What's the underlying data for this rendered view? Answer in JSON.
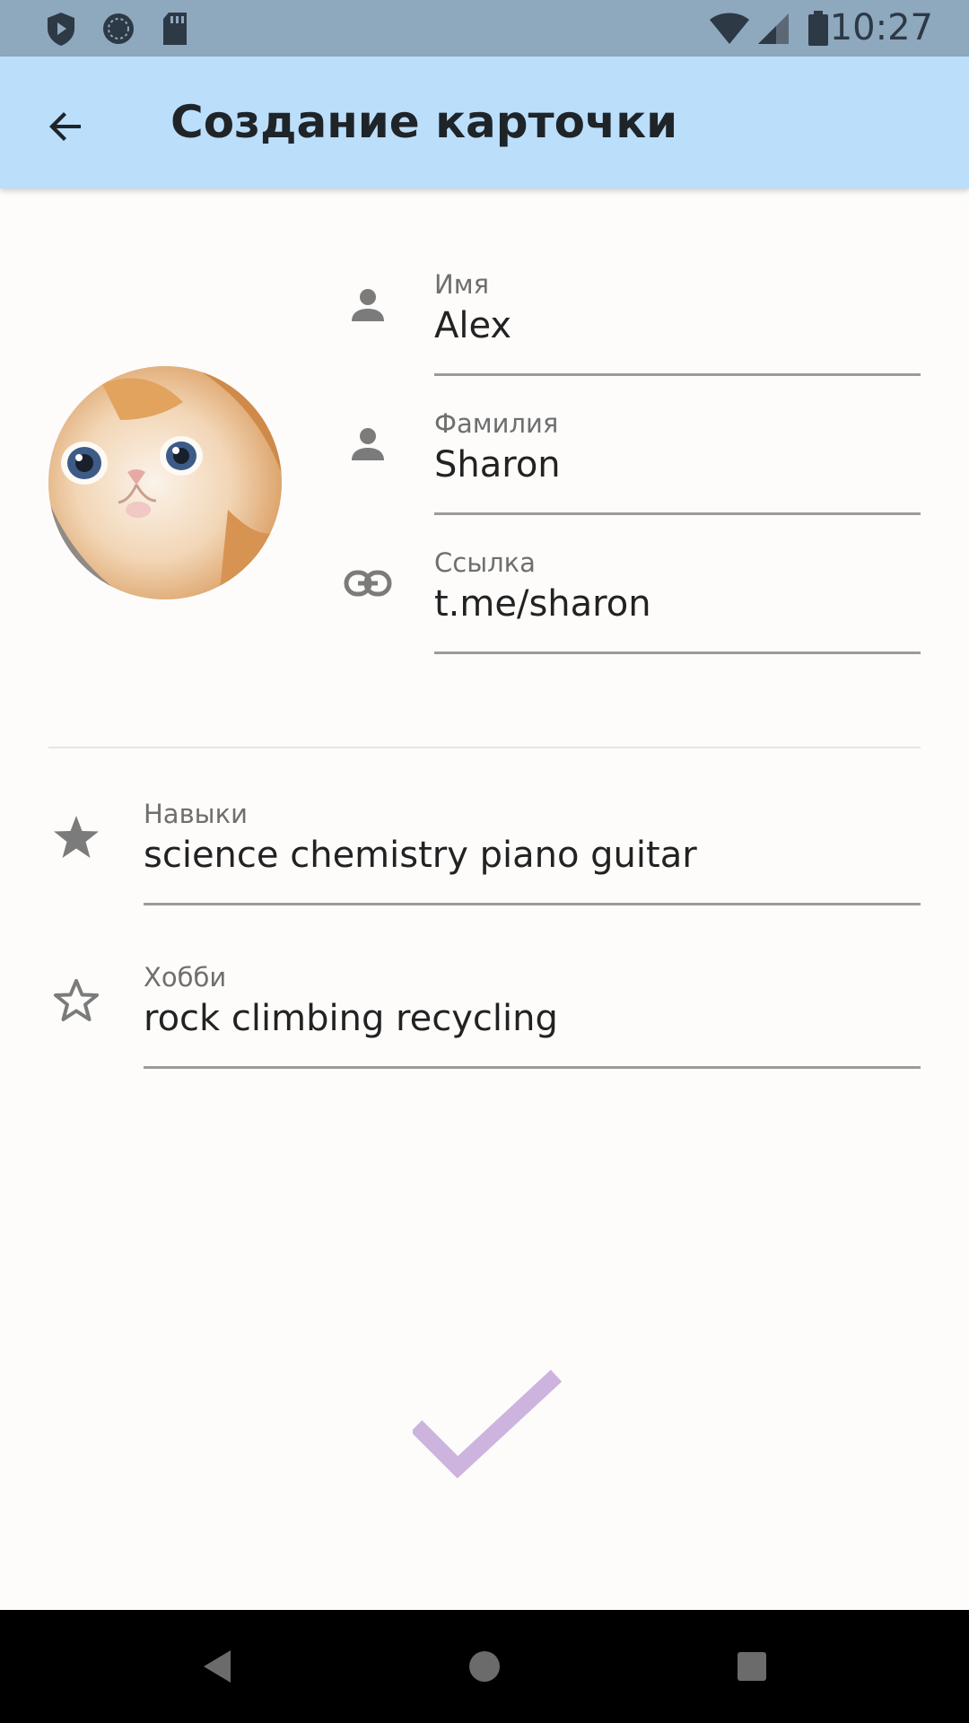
{
  "status_bar": {
    "time": "10:27",
    "icons": [
      "shield-icon",
      "sync-icon",
      "sd-card-icon",
      "wifi-icon",
      "signal-icon",
      "battery-icon"
    ]
  },
  "app_bar": {
    "title": "Создание карточки",
    "back_icon": "arrow-back-icon",
    "background": "#bbdefb"
  },
  "profile": {
    "avatar": "kitten-photo",
    "fields": [
      {
        "icon": "person-icon",
        "label": "Имя",
        "value": "Alex"
      },
      {
        "icon": "person-icon",
        "label": "Фамилия",
        "value": "Sharon"
      },
      {
        "icon": "link-icon",
        "label": "Ссылка",
        "value": "t.me/sharon"
      }
    ]
  },
  "details": {
    "fields": [
      {
        "icon": "star-filled-icon",
        "label": "Навыки",
        "value": "science chemistry piano guitar"
      },
      {
        "icon": "star-outline-icon",
        "label": "Хобби",
        "value": "rock climbing recycling"
      }
    ]
  },
  "submit": {
    "icon": "check-icon",
    "color": "#cdb4de"
  },
  "nav_bar": {
    "buttons": [
      "back-triangle-icon",
      "home-circle-icon",
      "recents-square-icon"
    ]
  }
}
